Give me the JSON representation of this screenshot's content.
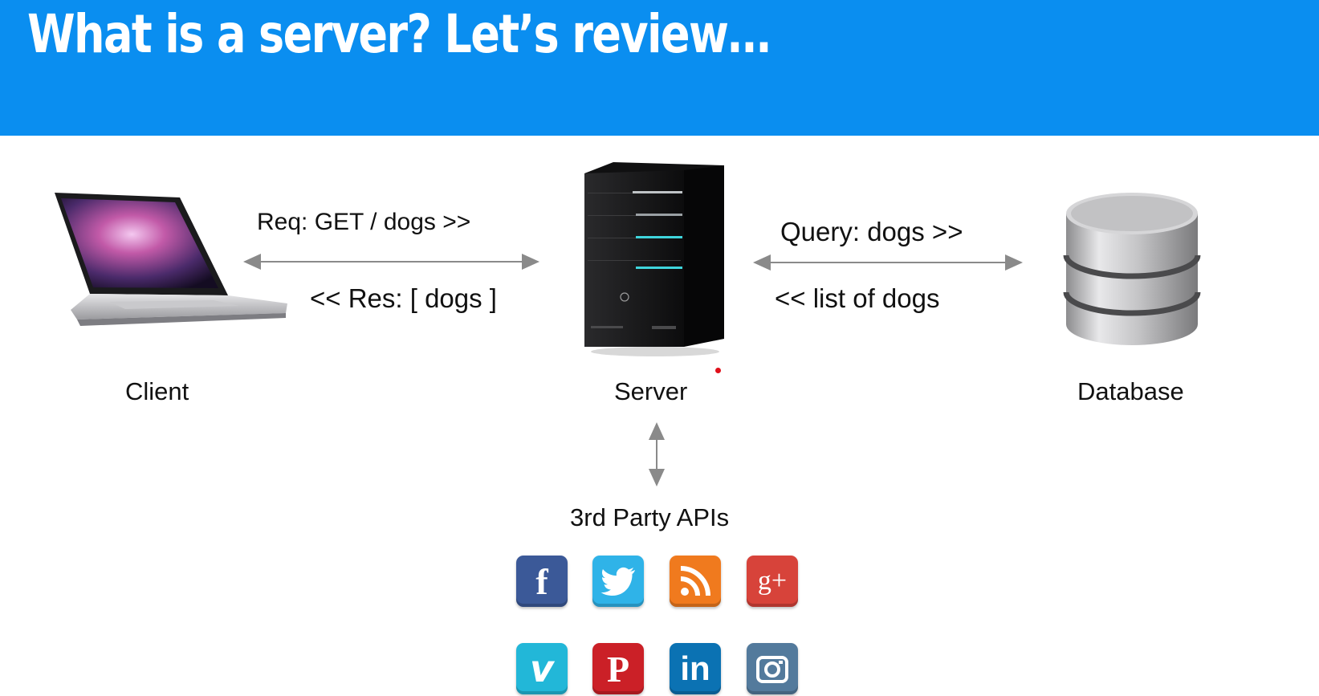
{
  "header": {
    "title": "What is a server? Let’s review…"
  },
  "nodes": {
    "client": "Client",
    "server": "Server",
    "database": "Database",
    "apis": "3rd Party APIs"
  },
  "messages": {
    "request": "Req: GET / dogs >>",
    "response": "<< Res: [ dogs ]",
    "query": "Query: dogs >>",
    "result": "<< list of dogs"
  },
  "api_icons": [
    {
      "name": "facebook-icon",
      "glyph": "f",
      "color": "#3b5998"
    },
    {
      "name": "twitter-icon",
      "glyph": "",
      "color": "#2fb3e8"
    },
    {
      "name": "rss-icon",
      "glyph": "",
      "color": "#f07a1e"
    },
    {
      "name": "google-plus-icon",
      "glyph": "g+",
      "color": "#d7433a"
    },
    {
      "name": "vimeo-icon",
      "glyph": "v",
      "color": "#22b7d8"
    },
    {
      "name": "pinterest-icon",
      "glyph": "P",
      "color": "#cb2027"
    },
    {
      "name": "linkedin-icon",
      "glyph": "in",
      "color": "#0b72b3"
    },
    {
      "name": "instagram-icon",
      "glyph": "",
      "color": "#537a9c"
    }
  ]
}
